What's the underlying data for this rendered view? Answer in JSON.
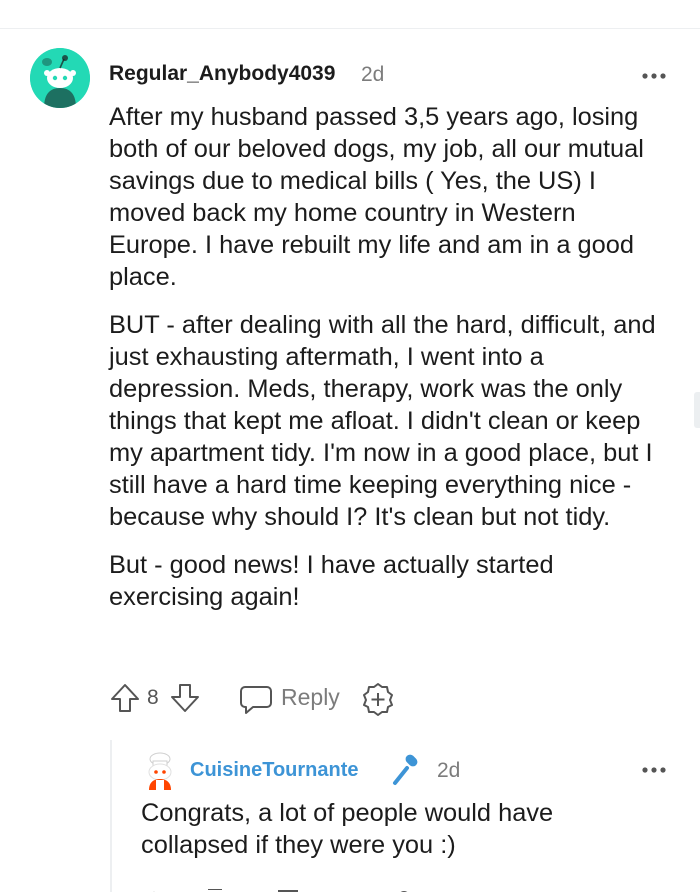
{
  "comment": {
    "username": "Regular_Anybody4039",
    "time": "2d",
    "paragraphs": [
      "After my husband passed 3,5 years ago, losing both of our beloved dogs, my job, all our mutual savings due to medical bills ( Yes, the US) I moved back my home country in Western Europe. I have rebuilt my life and am in a good place.",
      "BUT - after dealing with all the hard, difficult, and just exhausting aftermath, I went into a depression. Meds, therapy, work was the only things that kept me afloat. I didn't clean or keep my apartment tidy. I'm now in a good place, but I still have a hard time keeping everything nice - because why should I? It's clean but not tidy.",
      "But - good news! I have actually started exercising again!"
    ],
    "votes": "8",
    "reply_label": "Reply",
    "avatar_color": "#23d9b5"
  },
  "reply": {
    "username": "CuisineTournante",
    "time": "2d",
    "text": "Congrats, a lot of people would have collapsed if they were you :)",
    "username_color": "#3d94d6"
  },
  "icons": {
    "more": "more-options-icon",
    "upvote": "upvote-icon",
    "downvote": "downvote-icon",
    "reply": "reply-icon",
    "award": "add-award-icon",
    "mic": "microphone-icon"
  }
}
